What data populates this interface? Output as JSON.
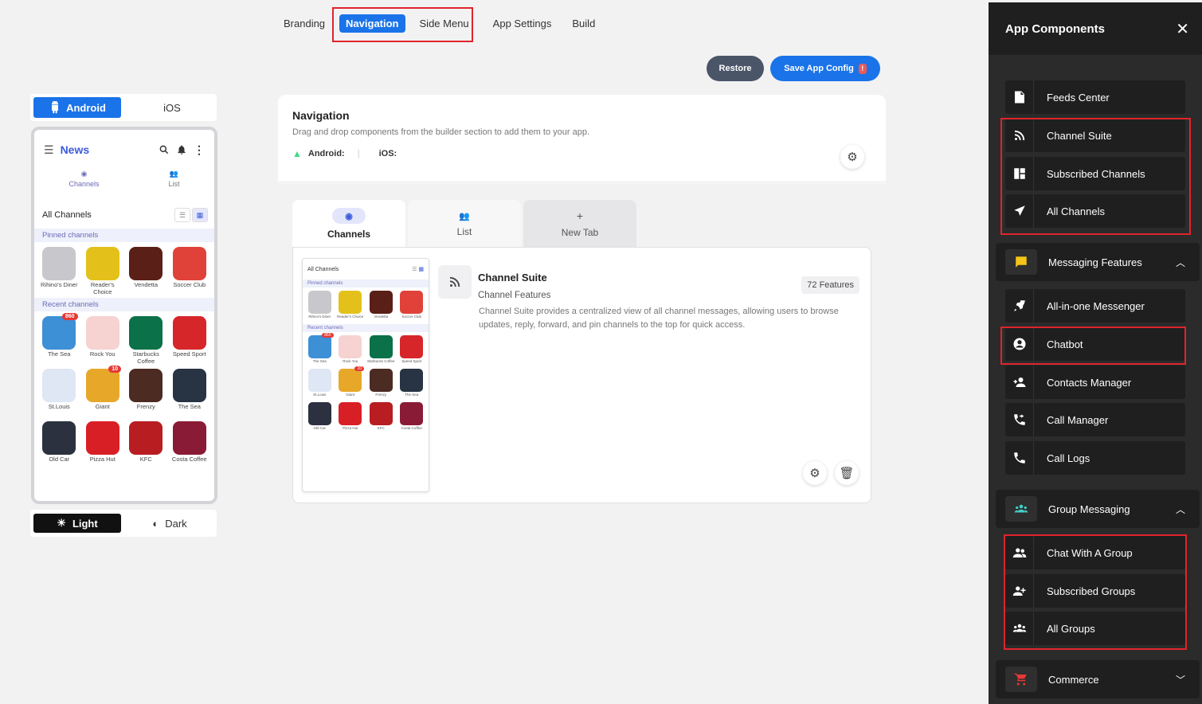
{
  "top_tabs": [
    "Branding",
    "Navigation",
    "Side Menu",
    "App Settings",
    "Build"
  ],
  "active_tab": "Navigation",
  "actions": {
    "restore": "Restore",
    "save": "Save App Config",
    "save_alert": "!"
  },
  "platform": {
    "android": "Android",
    "ios": "iOS",
    "active": "Android"
  },
  "phone": {
    "title": "News",
    "tabs": [
      "Channels",
      "List"
    ],
    "all_channels": "All Channels",
    "pinned_label": "Pinned channels",
    "recent_label": "Recent channels",
    "pinned": [
      {
        "name": "Rihino's Diner",
        "color": "#c8c8cc"
      },
      {
        "name": "Reader's Choice",
        "color": "#e3c11a"
      },
      {
        "name": "Vendetta",
        "color": "#5a1f16"
      },
      {
        "name": "Soccer Club",
        "color": "#e0423a"
      }
    ],
    "recent": [
      {
        "name": "The Sea",
        "color": "#3d8fd6",
        "badge": "860"
      },
      {
        "name": "Rock You",
        "color": "#f6d2d0"
      },
      {
        "name": "Starbucks Coffee",
        "color": "#0a7148"
      },
      {
        "name": "Speed Sport",
        "color": "#d6262a"
      },
      {
        "name": "St.Louis",
        "color": "#dfe6f4"
      },
      {
        "name": "Giant",
        "color": "#e7a829",
        "badge": "10"
      },
      {
        "name": "Frenzy",
        "color": "#4b2b22"
      },
      {
        "name": "The Sea",
        "color": "#283444"
      },
      {
        "name": "Old Car",
        "color": "#2c3140"
      },
      {
        "name": "Pizza Hut",
        "color": "#d91f26"
      },
      {
        "name": "KFC",
        "color": "#b81d22"
      },
      {
        "name": "Costa Coffee",
        "color": "#8a1b36"
      }
    ]
  },
  "theme": {
    "light": "Light",
    "dark": "Dark",
    "active": "Light"
  },
  "card": {
    "title": "Navigation",
    "description": "Drag and drop components from the builder section to add them to your app.",
    "android_label": "Android:",
    "ios_label": "iOS:",
    "tabs": [
      {
        "label": "Channels",
        "active": true
      },
      {
        "label": "List",
        "active": false
      },
      {
        "label": "New Tab",
        "active": false
      }
    ],
    "mini": {
      "all_channels": "All Channels",
      "pinned": "Pinned channels",
      "recent": "Recent channels"
    },
    "feature": {
      "title": "Channel Suite",
      "subtitle": "Channel Features",
      "count": "72 Features",
      "description": "Channel Suite provides a centralized view of all channel messages, allowing users to browse updates, reply, forward, and pin channels to the top for quick access."
    }
  },
  "sidebar": {
    "title": "App Components",
    "items": [
      {
        "label": "Feeds Center",
        "icon": "document-icon"
      },
      {
        "label": "Channel Suite",
        "icon": "rss-icon"
      },
      {
        "label": "Subscribed Channels",
        "icon": "dashboard-icon"
      },
      {
        "label": "All Channels",
        "icon": "send-icon"
      }
    ],
    "groups": [
      {
        "label": "Messaging Features",
        "icon": "message-icon",
        "color": "#f5c518",
        "expanded": true,
        "items": [
          {
            "label": "All-in-one Messenger",
            "icon": "rocket-icon"
          },
          {
            "label": "Chatbot",
            "icon": "account-circle-icon"
          },
          {
            "label": "Contacts Manager",
            "icon": "person-add-icon"
          },
          {
            "label": "Call Manager",
            "icon": "phone-forward-icon"
          },
          {
            "label": "Call Logs",
            "icon": "phone-icon"
          }
        ]
      },
      {
        "label": "Group Messaging",
        "icon": "groups-icon",
        "color": "#3fd1c8",
        "expanded": true,
        "items": [
          {
            "label": "Chat With A Group",
            "icon": "people-icon"
          },
          {
            "label": "Subscribed Groups",
            "icon": "group-add-icon"
          },
          {
            "label": "All Groups",
            "icon": "groups-icon"
          }
        ]
      },
      {
        "label": "Commerce",
        "icon": "cart-icon",
        "color": "#e53935",
        "expanded": false,
        "items": []
      }
    ]
  }
}
